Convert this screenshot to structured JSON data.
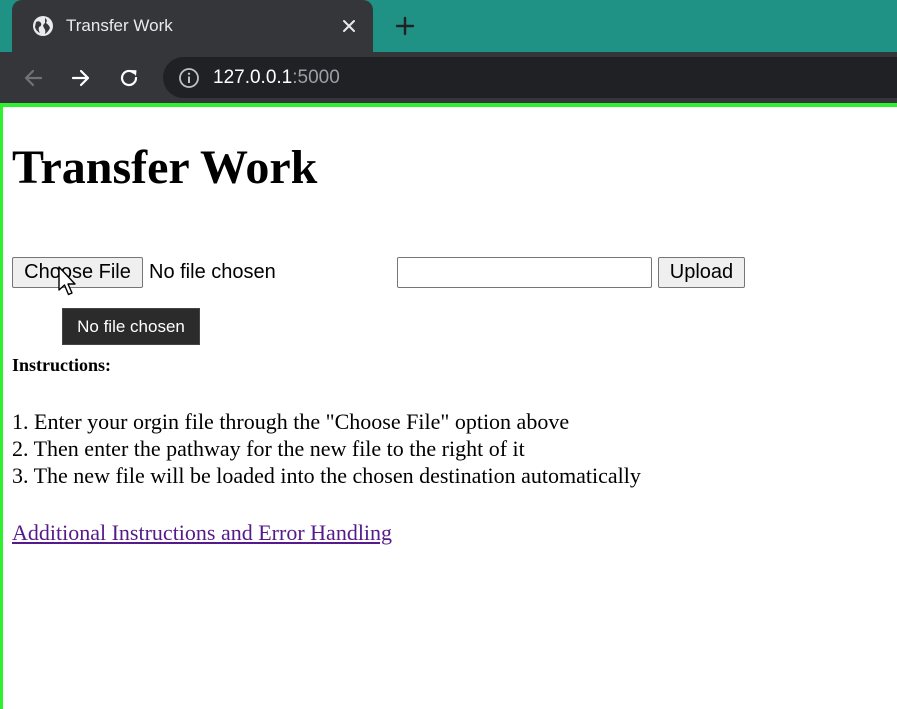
{
  "browser": {
    "tab_title": "Transfer Work",
    "url_host": "127.0.0.1",
    "url_port": ":5000"
  },
  "page": {
    "title": "Transfer Work",
    "choose_file_label": "Choose File",
    "file_status": "No file chosen",
    "path_value": "",
    "upload_label": "Upload",
    "tooltip": "No file chosen",
    "instructions_heading": "Instructions:",
    "instructions": [
      "1. Enter your orgin file through the \"Choose File\" option above",
      "2. Then enter the pathway for the new file to the right of it",
      "3. The new file will be loaded into the chosen destination automatically"
    ],
    "help_link": "Additional Instructions and Error Handling"
  },
  "colors": {
    "tab_strip": "#1f9285",
    "chrome_dark": "#35363a",
    "viewport_border": "#2ef02e",
    "visited_link": "#551a8b"
  },
  "icons": {
    "tab_favicon": "globe-icon",
    "tab_close": "close-icon",
    "new_tab": "plus-icon",
    "back": "arrow-left-icon",
    "forward": "arrow-right-icon",
    "reload": "reload-icon",
    "site_info": "info-icon",
    "pointer": "mouse-cursor-icon"
  }
}
